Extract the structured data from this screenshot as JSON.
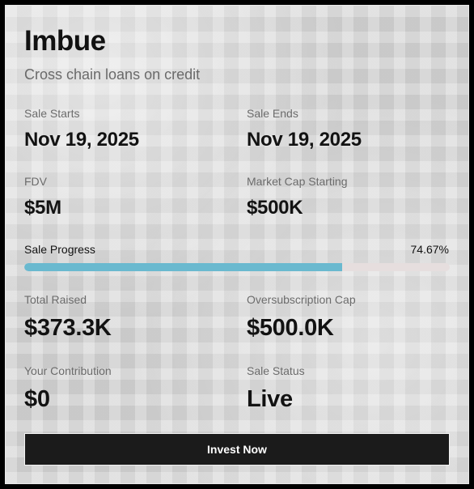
{
  "project": {
    "name": "Imbue",
    "tagline": "Cross chain loans on credit"
  },
  "sale_starts": {
    "label": "Sale Starts",
    "value": "Nov 19, 2025"
  },
  "sale_ends": {
    "label": "Sale Ends",
    "value": "Nov 19, 2025"
  },
  "fdv": {
    "label": "FDV",
    "value": "$5M"
  },
  "market_cap": {
    "label": "Market Cap Starting",
    "value": "$500K"
  },
  "progress": {
    "label": "Sale Progress",
    "percent_text": "74.67%",
    "fraction": 0.7467,
    "fill_color": "#6ab9cf",
    "track_color": "#e6dede"
  },
  "total_raised": {
    "label": "Total Raised",
    "value": "$373.3K"
  },
  "oversubscription_cap": {
    "label": "Oversubscription Cap",
    "value": "$500.0K"
  },
  "your_contribution": {
    "label": "Your Contribution",
    "value": "$0"
  },
  "sale_status": {
    "label": "Sale Status",
    "value": "Live"
  },
  "actions": {
    "invest_label": "Invest Now"
  }
}
